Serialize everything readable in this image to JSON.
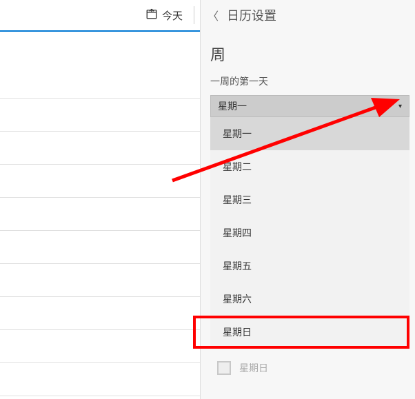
{
  "calendar": {
    "today_label": "今天"
  },
  "panel": {
    "title": "日历设置",
    "section": "周",
    "field_label": "一周的第一天"
  },
  "dropdown": {
    "selected": "星期一",
    "items": [
      "星期一",
      "星期二",
      "星期三",
      "星期四",
      "星期五",
      "星期六",
      "星期日"
    ]
  },
  "checkbox": {
    "label": "星期日"
  },
  "annotation": {
    "arrow_color": "#ff0000",
    "box_color": "#ff0000"
  }
}
